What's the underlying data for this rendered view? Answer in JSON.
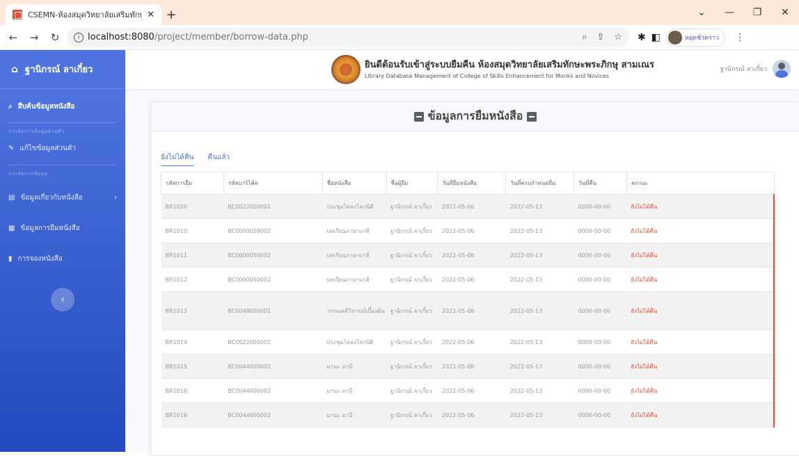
{
  "browser": {
    "tab_title": "CSEMN-ห้องสมุดวิทยาลัยเสริมทักษะ",
    "tab_close": "✕",
    "new_tab": "+",
    "url_host": "localhost:8080",
    "url_path": "/project/member/borrow-data.php",
    "profile_label": "หยุดชั่วคราว",
    "window_controls": [
      "⌄",
      "—",
      "❐",
      "✕"
    ]
  },
  "sidebar": {
    "brand": "ฐานิกรณ์ ลาเกี๋ยว",
    "search_item": "สืบค้นข้อมูลหนังสือ",
    "heading_1": "การจัดการข้อมูลส่วนตัว",
    "edit_item": "แก้ไขข้อมูลส่วนตัว",
    "heading_2": "การจัดการข้อมูล",
    "items": [
      {
        "label": "ข้อมูลเกี่ยวกับหนังสือ",
        "chevron": "›"
      },
      {
        "label": "ข้อมูลการยืมหนังสือ"
      },
      {
        "label": "การจองหนังสือ"
      }
    ],
    "toggle_glyph": "‹"
  },
  "header": {
    "title": "ยินดีต้อนรับเข้าสู่ระบบยืมคืน ห้องสมุดวิทยาลัยเสริมทักษะพระภิกษุ สามเณร",
    "subtitle": "Library Database Management of College of Skills Enhancement for Monks and Novices",
    "user_name": "ฐานิกรณ์ ลาเกี๋ยว"
  },
  "card": {
    "title": "ข้อมูลการยืมหนังสือ",
    "tabs": [
      "ยังไม่ได้คืน",
      "คืนแล้ว"
    ],
    "columns": [
      "รหัสการยืม",
      "รหัสบาร์โค้ด",
      "ชื่อหนังสือ",
      "ชื่อผู้ยืม",
      "วันที่ยืมหนังสือ",
      "วันที่ครบกำหนดยืม",
      "วันที่คืน",
      "สถานะ"
    ],
    "rows": [
      [
        "BR1020",
        "BC0022000001",
        "ประชุมโคลงโลกนิติ",
        "ฐานิกรณ์ ลาเกี๋ยว",
        "2022-05-06",
        "2022-05-13",
        "0000-00-00",
        "ยังไม่ได้คืน"
      ],
      [
        "BR1010",
        "BC0000050002",
        "บทเรียนภาษาบาลี",
        "ฐานิกรณ์ ลาเกี๋ยว",
        "2022-05-06",
        "2022-05-13",
        "0000-00-00",
        "ยังไม่ได้คืน"
      ],
      [
        "BR1011",
        "BC0000050002",
        "บทเรียนภาษาบาลี",
        "ฐานิกรณ์ ลาเกี๋ยว",
        "2022-05-06",
        "2022-05-13",
        "0000-00-00",
        "ยังไม่ได้คืน"
      ],
      [
        "BR1012",
        "BC0000050002",
        "บทเรียนภาษาบาลี",
        "ฐานิกรณ์ ลาเกี๋ยว",
        "2022-05-06",
        "2022-05-13",
        "0000-00-00",
        "ยังไม่ได้คืน"
      ],
      [
        "BR1013",
        "BC0048000001",
        "วรรณคดีวิจารณ์เบื้องต้น",
        "ฐานิกรณ์ ลาเกี๋ยว",
        "2022-05-06",
        "2022-05-13",
        "0000-00-00",
        "ยังไม่ได้คืน"
      ],
      [
        "BR1014",
        "BC0022000001",
        "ประชุมโคลงโลกนิติ",
        "ฐานิกรณ์ ลาเกี๋ยว",
        "2022-05-06",
        "2022-05-13",
        "0000-00-00",
        "ยังไม่ได้คืน"
      ],
      [
        "BR1015",
        "BC0044000002",
        "มานะ มานี",
        "ฐานิกรณ์ ลาเกี๋ยว",
        "2022-05-06",
        "2022-05-13",
        "0000-00-00",
        "ยังไม่ได้คืน"
      ],
      [
        "BR1016",
        "BC0044000002",
        "มานะ มานี",
        "ฐานิกรณ์ ลาเกี๋ยว",
        "2022-05-06",
        "2022-05-13",
        "0000-00-00",
        "ยังไม่ได้คืน"
      ],
      [
        "BR1018",
        "BC0044000002",
        "มานะ มานี",
        "ฐานิกรณ์ ลาเกี๋ยว",
        "2022-05-06",
        "2022-05-13",
        "0000-00-00",
        "ยังไม่ได้คืน"
      ]
    ]
  }
}
